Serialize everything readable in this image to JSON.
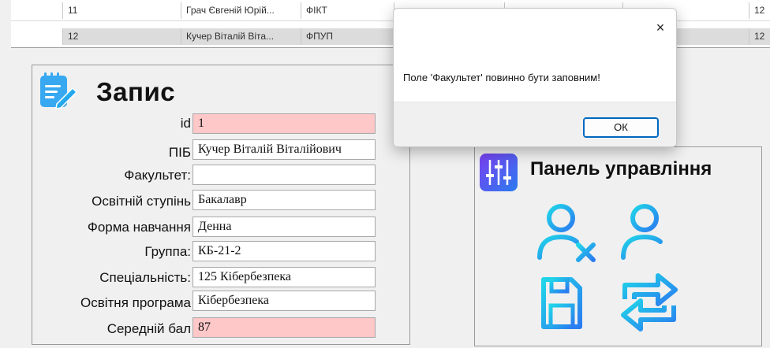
{
  "grid": {
    "rows": [
      {
        "num": "11",
        "name": "Грач Євгеній Юрій...",
        "faculty": "ФІКТ",
        "score": "12"
      },
      {
        "num": "12",
        "name": "Кучер Віталій Віта...",
        "faculty": "ФПУП",
        "score": "12"
      }
    ]
  },
  "record": {
    "title": "Запис",
    "fields": [
      {
        "label": "id",
        "value": "1"
      },
      {
        "label": "ПІБ",
        "value": "Кучер Віталій Віталійович"
      },
      {
        "label": "Факультет:",
        "value": ""
      },
      {
        "label": "Освітній ступінь",
        "value": "Бакалавр"
      },
      {
        "label": "Форма навчання",
        "value": "Денна"
      },
      {
        "label": "Группа:",
        "value": "КБ-21-2"
      },
      {
        "label": "Спеціальність:",
        "value": "125 Кібербезпека"
      },
      {
        "label": "Освітня програма",
        "value": "Кібербезпека"
      },
      {
        "label": "Середній бал",
        "value": "87"
      }
    ]
  },
  "control_panel": {
    "title": "Панель управління",
    "buttons": [
      "remove-user-icon",
      "add-user-icon",
      "save-icon",
      "swap-icon"
    ]
  },
  "dialog": {
    "message": "Поле 'Факультет' повинно бути заповним!",
    "ok_label": "ОК",
    "close_symbol": "×"
  },
  "colors": {
    "required_field_bg": "#ffc8c8",
    "icon_gradient_start": "#20d6e8",
    "icon_gradient_end": "#2a7bf0",
    "dialog_button_border": "#0067c0"
  }
}
